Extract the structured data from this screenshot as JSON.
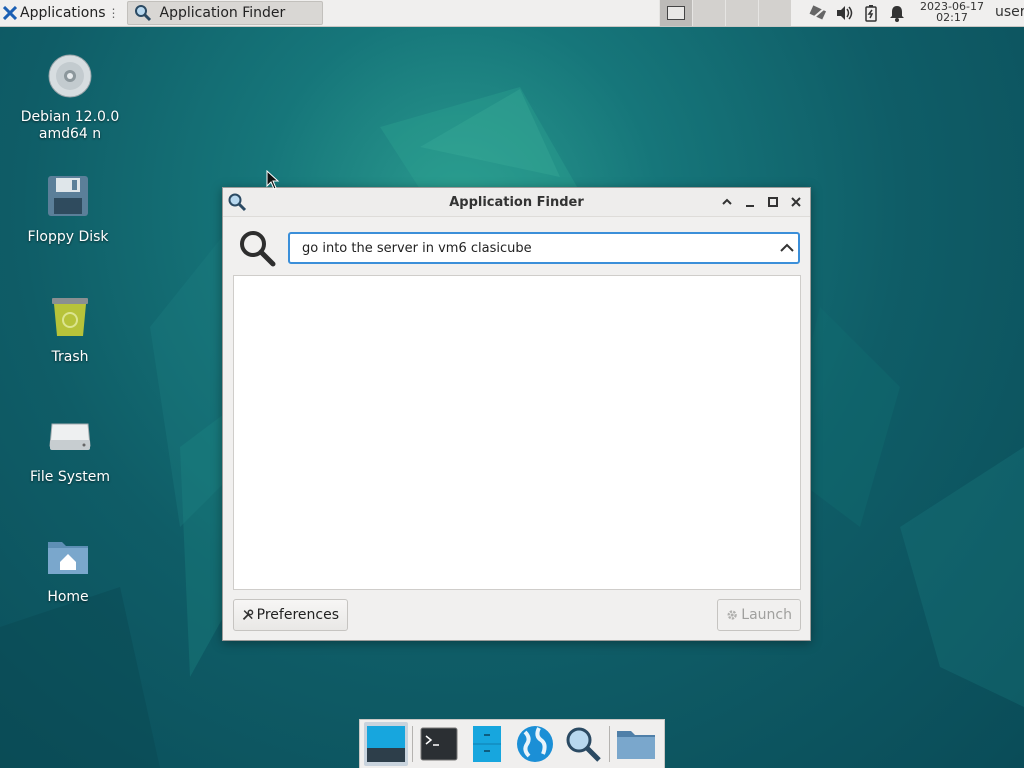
{
  "panel": {
    "apps_label": "Applications",
    "apps_sep": "⋮",
    "task_label": "Application Finder",
    "clock_date": "2023-06-17",
    "clock_time": "02:17",
    "user": "user"
  },
  "desktop": {
    "icons": [
      {
        "label": "Debian 12.0.0 amd64 n"
      },
      {
        "label": "Floppy Disk"
      },
      {
        "label": "Trash"
      },
      {
        "label": "File System"
      },
      {
        "label": "Home"
      }
    ]
  },
  "window": {
    "title": "Application Finder",
    "search_value": "go into the server in vm6 clasicube",
    "preferences_label": "Preferences",
    "launch_label": "Launch"
  },
  "colors": {
    "accent": "#3b8fd9",
    "panel": "#f0efee"
  }
}
